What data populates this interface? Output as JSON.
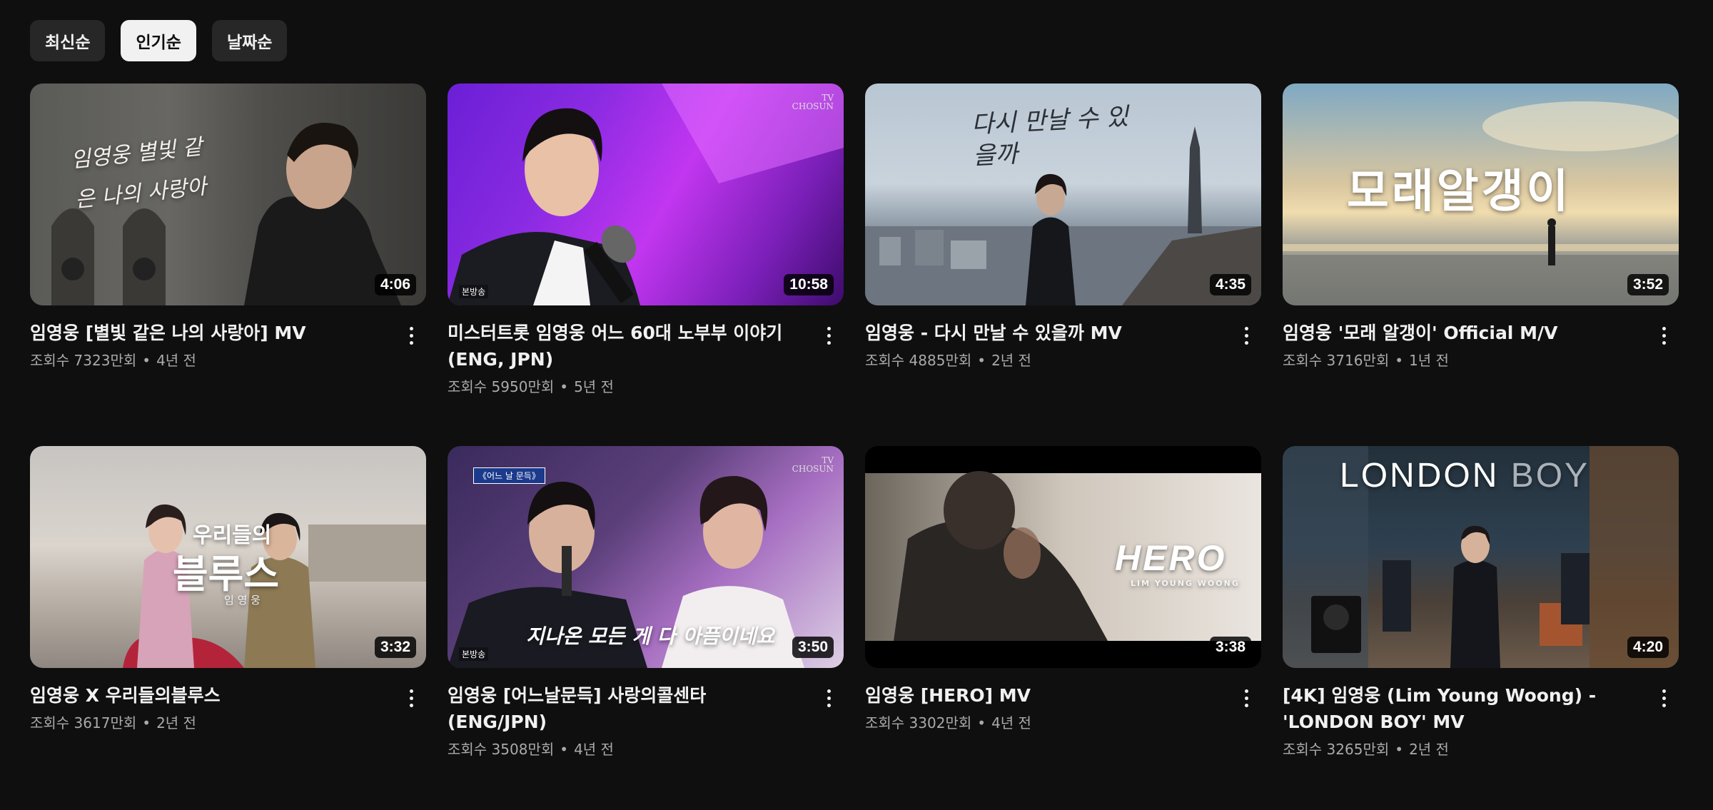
{
  "chips": [
    {
      "label": "최신순",
      "active": false
    },
    {
      "label": "인기순",
      "active": true
    },
    {
      "label": "날짜순",
      "active": false
    }
  ],
  "videos": [
    {
      "title": "임영웅 [별빛 같은 나의 사랑아] MV",
      "views": "조회수 7323만회",
      "age": "4년 전",
      "duration": "4:06",
      "overlay": "임영웅 별빛 같은 나의 사랑아"
    },
    {
      "title": "미스터트롯 임영웅 어느 60대 노부부 이야기 (ENG, JPN)",
      "views": "조회수 5950만회",
      "age": "5년 전",
      "duration": "10:58",
      "logo": "TV CHOSUN",
      "badge": "본방송"
    },
    {
      "title": "임영웅 - 다시 만날 수 있을까 MV",
      "views": "조회수 4885만회",
      "age": "2년 전",
      "duration": "4:35",
      "overlay": "다시 만날 수 있을까"
    },
    {
      "title": "임영웅 '모래 알갱이' Official M/V",
      "views": "조회수 3716만회",
      "age": "1년 전",
      "duration": "3:52",
      "overlay": "모래알갱이"
    },
    {
      "title": "임영웅 X 우리들의블루스",
      "views": "조회수 3617만회",
      "age": "2년 전",
      "duration": "3:32",
      "overlay": "우리들의",
      "overlay2": "블루스",
      "overlay3": "임 영 웅"
    },
    {
      "title": "임영웅 [어느날문득] 사랑의콜센타 (ENG/JPN)",
      "views": "조회수 3508만회",
      "age": "4년 전",
      "duration": "3:50",
      "logo": "TV CHOSUN",
      "badge": "본방송",
      "overlay": "지나온 모든 게 다 아픔이네요",
      "caption_tag": "《어느 날 문득》"
    },
    {
      "title": "임영웅 [HERO] MV",
      "views": "조회수 3302만회",
      "age": "4년 전",
      "duration": "3:38",
      "overlay": "HERO",
      "overlay2": "LIM YOUNG WOONG"
    },
    {
      "title": "[4K] 임영웅 (Lim Young Woong) - 'LONDON BOY' MV",
      "views": "조회수 3265만회",
      "age": "2년 전",
      "duration": "4:20",
      "overlay": "LONDON",
      "overlay2": "BOY"
    }
  ]
}
